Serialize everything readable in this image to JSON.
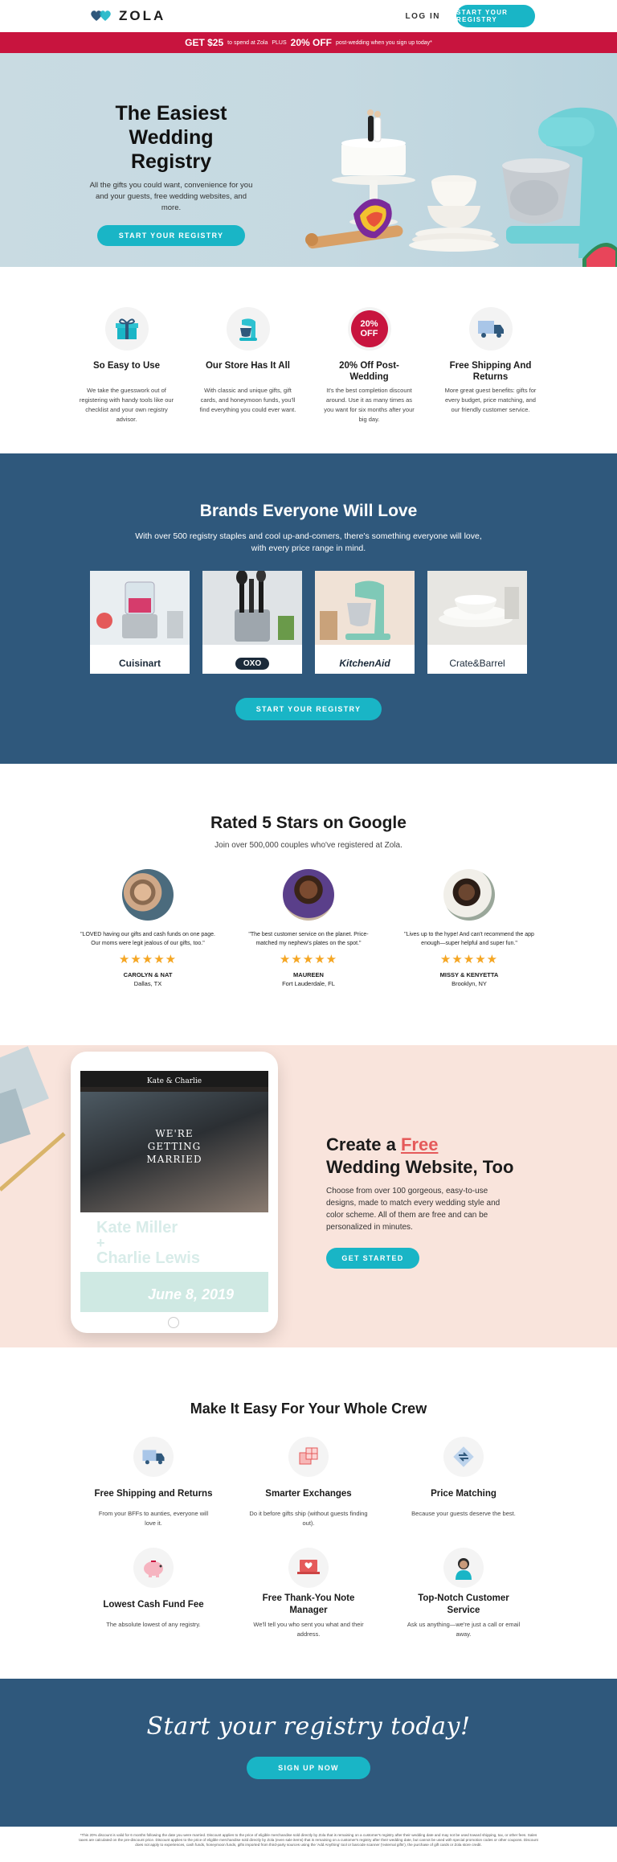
{
  "nav": {
    "logo": "ZOLA",
    "login": "LOG IN",
    "cta": "START YOUR REGISTRY"
  },
  "promo": {
    "amount": "GET $25",
    "text1": "to spend at Zola",
    "plus": "PLUS",
    "discount": "20% OFF",
    "text2": "post-wedding when you sign up today*"
  },
  "hero": {
    "title_line1": "The Easiest",
    "title_line2": "Wedding Registry",
    "body": "All the gifts you could want, convenience for you and your guests, free wedding websites, and more.",
    "cta": "START YOUR REGISTRY"
  },
  "features": [
    {
      "title": "So Easy to Use",
      "body": "We take the guesswork out of registering with handy tools like our checklist and your own registry advisor."
    },
    {
      "title": "Our Store Has It All",
      "body": "With classic and unique gifts, gift cards, and honeymoon funds, you'll find everything you could ever want."
    },
    {
      "title": "20% Off Post-Wedding",
      "body": "It's the best completion discount around. Use it as many times as you want for six months after your big day.",
      "badge": "20% OFF"
    },
    {
      "title": "Free Shipping And Returns",
      "body": "More great guest benefits: gifts for every budget, price matching, and our friendly customer service."
    }
  ],
  "brands": {
    "title": "Brands Everyone Will Love",
    "subtitle": "With over 500 registry staples and cool up-and-comers, there's something everyone will love, with every price range in mind.",
    "items": [
      {
        "name": "Cuisinart"
      },
      {
        "name": "OXO"
      },
      {
        "name": "KitchenAid"
      },
      {
        "name": "Crate&Barrel"
      }
    ],
    "cta": "START YOUR REGISTRY"
  },
  "reviews": {
    "title": "Rated 5 Stars on Google",
    "subtitle": "Join over 500,000 couples who've registered at Zola.",
    "stars": "★★★★★",
    "items": [
      {
        "quote": "\"LOVED having our gifts and cash funds on one page. Our moms were legit jealous of our gifts, too.\"",
        "name": "CAROLYN & NAT",
        "city": "Dallas, TX"
      },
      {
        "quote": "\"The best customer service on the planet. Price-matched my nephew's plates on the spot.\"",
        "name": "MAUREEN",
        "city": "Fort Lauderdale, FL"
      },
      {
        "quote": "\"Lives up to the hype! And can't recommend the app enough—super helpful and super fun.\"",
        "name": "MISSY & KENYETTA",
        "city": "Brooklyn, NY"
      }
    ]
  },
  "website": {
    "title_prefix": "Create a ",
    "title_free": "Free",
    "title_line2": "Wedding Website, Too",
    "body": "Choose from over 100 gorgeous, easy-to-use designs, made to match every wedding style and color scheme. All of them are free and can be personalized in minutes.",
    "cta": "GET STARTED",
    "screen": {
      "site_title": "Kate & Charlie",
      "overlay": "WE'RE GETTING MARRIED",
      "names_line1": "Kate Miller",
      "names_plus": "+",
      "names_line2": "Charlie Lewis",
      "date": "June 8, 2019"
    }
  },
  "crew": {
    "title": "Make It Easy For Your Whole Crew",
    "items": [
      {
        "title": "Free Shipping and Returns",
        "body": "From your BFFs to aunties, everyone will love it."
      },
      {
        "title": "Smarter Exchanges",
        "body": "Do it before gifts ship (without guests finding out)."
      },
      {
        "title": "Price Matching",
        "body": "Because your guests deserve the best."
      },
      {
        "title": "Lowest Cash Fund Fee",
        "body": "The absolute lowest of any registry."
      },
      {
        "title": "Free Thank-You Note Manager",
        "body": "We'll tell you who sent you what and their address."
      },
      {
        "title": "Top-Notch Customer Service",
        "body": "Ask us anything—we're just a call or email away."
      }
    ]
  },
  "cta": {
    "script": "Start your registry today!",
    "button": "SIGN UP NOW"
  },
  "fineprint": "*This 20% discount is valid for 6 months following the date you were married. Discount applies to the price of eligible merchandise sold directly by Zola that is remaining on a customer's registry after their wedding date and may not be used toward shipping, tax, or other fees. Sales taxes are calculated on the pre-discount price. Discount applies to the price of eligible merchandise sold directly by Zola (even sale items) that is remaining on a customer's registry after their wedding date, but cannot be used with special promotion codes or other coupons. Discount does not apply to experiences, cash funds, honeymoon funds, gifts imported from third-party sources using the 'Add Anything' tool or barcode scanner ('external gifts'), the purchase of gift cards or Zola store credit.",
  "colors": {
    "teal": "#19b5c6",
    "promo_red": "#c8143e",
    "navy": "#2f587c",
    "blush": "#f9e4dc",
    "hero_blue": "#c9dbe2",
    "star": "#f5a623"
  }
}
